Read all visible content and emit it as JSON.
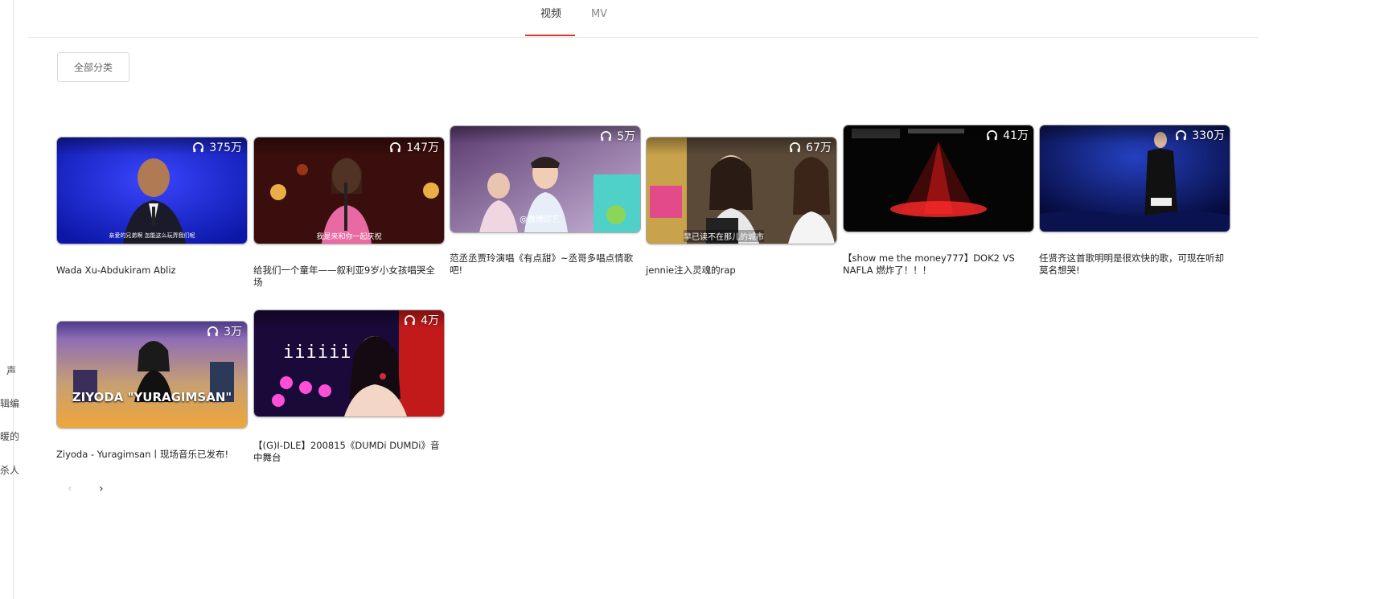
{
  "tabs": [
    {
      "label": "视频",
      "active": true
    },
    {
      "label": "MV",
      "active": false
    }
  ],
  "category_button": "全部分类",
  "left_fragments": [
    "声",
    "辑编",
    "暖的",
    "杀人"
  ],
  "videos": [
    {
      "title": "Wada Xu-Abdukiram Abliz",
      "plays": "375万",
      "caption": "亲爱的兄弟啊 怎能这么玩弄我们呢"
    },
    {
      "title": "给我们一个童年——叙利亚9岁小女孩唱哭全场",
      "plays": "147万",
      "caption": "我是来和你一起庆祝"
    },
    {
      "title": "范丞丞贾玲演唱《有点甜》~丞哥多唱点情歌吧!",
      "plays": "5万",
      "caption": "@微博综艺"
    },
    {
      "title": "jennie注入灵魂的rap",
      "plays": "67万",
      "caption": "早已读不在那儿的城市"
    },
    {
      "title": "【show me the money777】DOK2 VS NAFLA 燃炸了！！！",
      "plays": "41万",
      "caption": ""
    },
    {
      "title": "任贤齐这首歌明明是很欢快的歌，可现在听却莫名想哭!",
      "plays": "330万",
      "caption": ""
    },
    {
      "title": "Ziyoda - Yuragimsan丨现场音乐已发布!",
      "plays": "3万",
      "caption": "ZIYODA \"YURAGIMSAN\""
    },
    {
      "title": "【(G)I-DLE】200815《DUMDi DUMDi》音中舞台",
      "plays": "4万",
      "caption": "iiiiii"
    }
  ],
  "pager": {
    "prev": "‹",
    "next": "›"
  },
  "colors": {
    "accent": "#d33a31",
    "divider": "#e6e6e6"
  }
}
